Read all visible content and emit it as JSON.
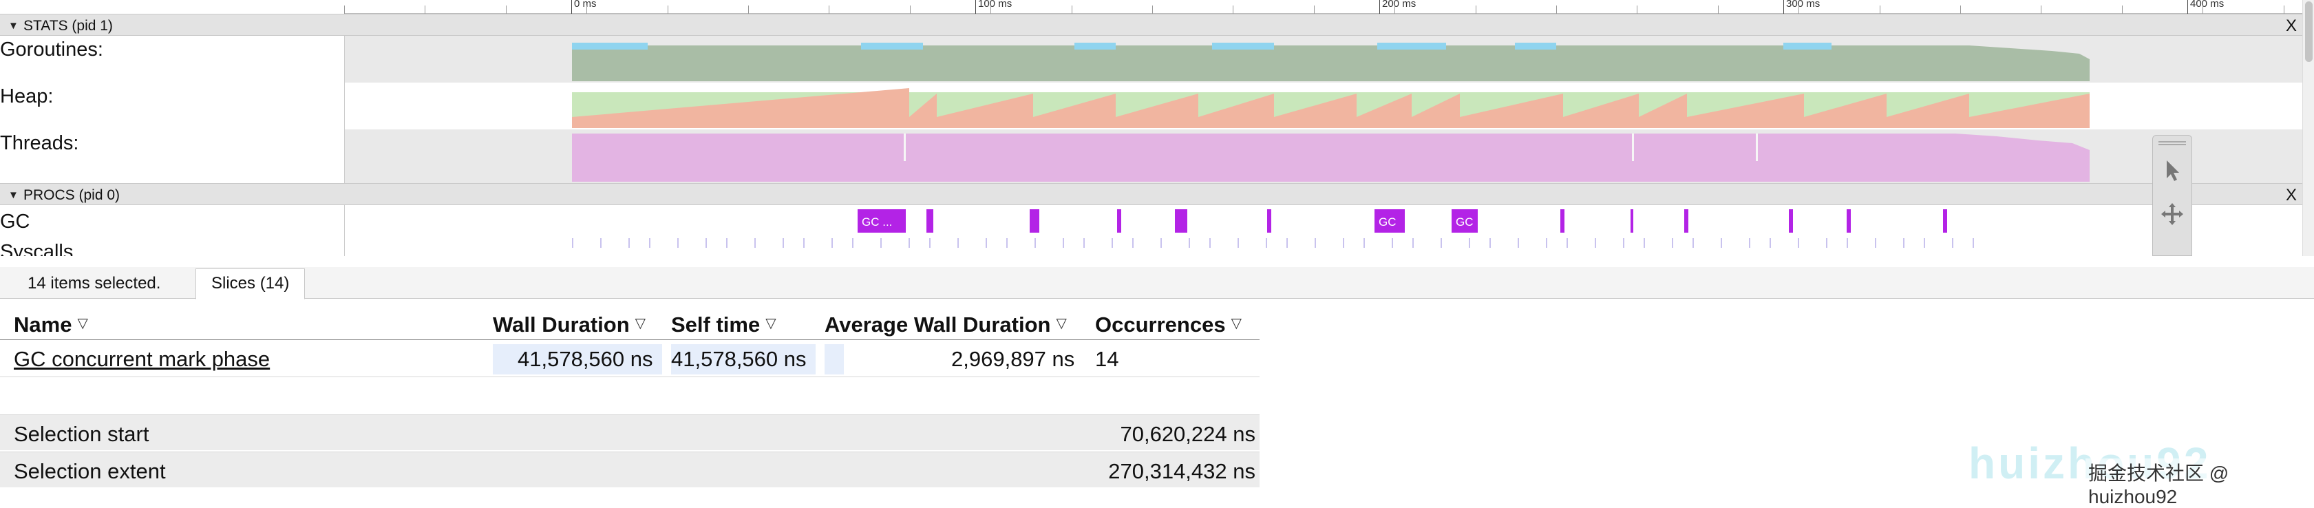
{
  "ruler": {
    "ticks": [
      "0 ms",
      "100 ms",
      "200 ms",
      "300 ms",
      "400 ms"
    ]
  },
  "stats_section": {
    "title": "STATS (pid 1)",
    "close": "X"
  },
  "procs_section": {
    "title": "PROCS (pid 0)",
    "close": "X"
  },
  "tracks": {
    "goroutines": "Goroutines:",
    "heap": "Heap:",
    "threads": "Threads:",
    "gc": "GC",
    "syscalls": "Syscalls"
  },
  "gc_slice_labels": [
    "GC ...",
    "GC",
    "GC"
  ],
  "colors": {
    "goroutines_runnable": "#8fd4ef",
    "goroutines_running": "#a9bda6",
    "heap_alloc": "#f1b5a0",
    "heap_next_gc": "#c9e7bb",
    "threads": "#e3b4e3",
    "gc_slice": "#b323e6",
    "header_bg": "#e3e3e3",
    "selection_bg": "#e6eefb"
  },
  "bottom_panel": {
    "selection_count": "14 items selected.",
    "tab_label": "Slices (14)",
    "columns": [
      "Name",
      "Wall Duration",
      "Self time",
      "Average Wall Duration",
      "Occurrences"
    ],
    "rows": [
      {
        "name": "GC concurrent mark phase",
        "wall_duration": "41,578,560 ns",
        "self_time": "41,578,560 ns",
        "average_wall_duration": "2,969,897 ns",
        "occurrences": "14"
      }
    ],
    "selection_start_label": "Selection start",
    "selection_start_value": "70,620,224 ns",
    "selection_extent_label": "Selection extent",
    "selection_extent_value": "270,314,432 ns"
  },
  "watermark": {
    "text": "掘金技术社区 @ huizhou92",
    "faint": "huizhou92"
  }
}
